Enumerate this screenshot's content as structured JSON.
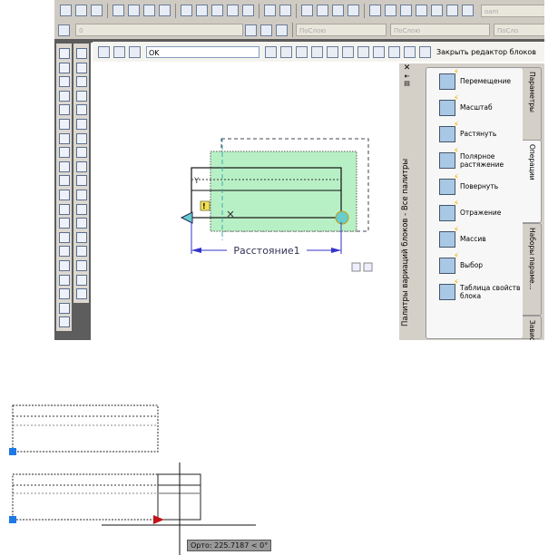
{
  "toolbar_row1": {
    "icons": [
      "new-icon",
      "open-icon",
      "save-icon",
      "print-icon",
      "preview-icon",
      "plot-icon",
      "publish-icon",
      "cut-icon",
      "copy-icon",
      "paste-icon",
      "match-properties-icon",
      "block-editor-icon",
      "undo-icon",
      "redo-icon",
      "pan-icon",
      "zoom-realtime-icon",
      "zoom-window-icon",
      "zoom-previous-icon",
      "properties-icon",
      "design-center-icon",
      "tool-palettes-icon",
      "sheet-set-icon",
      "markup-icon",
      "calculator-icon",
      "help-icon"
    ],
    "search_value": "oam"
  },
  "toolbar_row2": {
    "layer_value": "0",
    "color_value": "ПоСлою",
    "linetype_value": "ПоСлою",
    "lineweight_value": "ПоСло"
  },
  "block_editor": {
    "icons_left": [
      "edit-block-icon",
      "save-block-icon",
      "save-block-as-icon"
    ],
    "block_name": "OK",
    "icons_right": [
      "authoring-palettes-icon",
      "parameter-icon",
      "action-icon",
      "define-attribute-icon",
      "visibility-icon",
      "lookup-table-icon",
      "test-block-icon",
      "parameter-manager-icon",
      "learn-icon",
      "fx-icon",
      "help-icon"
    ],
    "close_label": "Закрыть редактор блоков"
  },
  "left_toolbar_draw": [
    "line-icon",
    "construction-line-icon",
    "polyline-icon",
    "polygon-icon",
    "rectangle-icon",
    "arc-icon",
    "circle-icon",
    "revision-cloud-icon",
    "spline-icon",
    "ellipse-icon",
    "ellipse-arc-icon",
    "insert-block-icon",
    "make-block-icon",
    "point-icon",
    "hatch-icon",
    "gradient-icon",
    "region-icon",
    "table-icon",
    "text-icon",
    "add-selected-icon"
  ],
  "left_toolbar_modify": [
    "erase-icon",
    "copy-object-icon",
    "mirror-icon",
    "offset-icon",
    "array-icon",
    "move-icon",
    "rotate-icon",
    "scale-icon",
    "stretch-icon",
    "trim-icon",
    "extend-icon",
    "break-at-point-icon",
    "break-icon",
    "join-icon",
    "chamfer-icon",
    "fillet-icon",
    "blend-icon",
    "explode-icon"
  ],
  "palette": {
    "title": "Палитры вариаций блоков - Все палитры",
    "items": [
      "Перемещение",
      "Масштаб",
      "Растянуть",
      "Полярное растяжение",
      "Повернуть",
      "Отражение",
      "Массив",
      "Выбор",
      "Таблица свойств блока"
    ],
    "tabs": [
      "Параметры",
      "Операции",
      "Наборы параме...",
      "Зависимости"
    ]
  },
  "drawing": {
    "dimension_label": "Расстояние1",
    "warning_mark": "!"
  },
  "ortho_tooltip": "Орто: 225.7187 < 0°"
}
